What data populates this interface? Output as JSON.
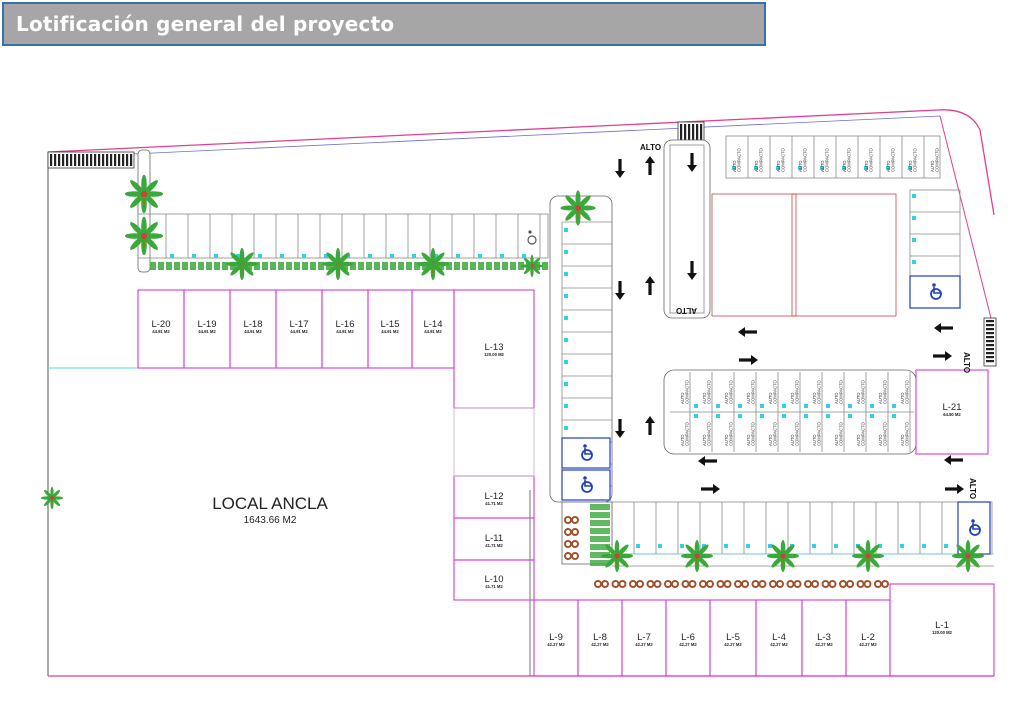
{
  "title": "Lotificación general del proyecto",
  "colors": {
    "banner_bg": "#a6a6a6",
    "banner_border": "#3a6fa7",
    "banner_text": "#ffffff",
    "lot_outline": "#d63ad6",
    "boundary": "#e0408f",
    "parking_line": "#8a8a8a",
    "accessible_blue": "#1f3fbf",
    "plant_green": "#3aa83a",
    "planter_brown": "#a0522d",
    "parking_dot": "#2fd3e6"
  },
  "anchor": {
    "name": "LOCAL ANCLA",
    "area": "1643.66 M2"
  },
  "lots": [
    {
      "id": "L-20",
      "area": "44.91 M2"
    },
    {
      "id": "L-19",
      "area": "44.91 M2"
    },
    {
      "id": "L-18",
      "area": "44.91 M2"
    },
    {
      "id": "L-17",
      "area": "44.91 M2"
    },
    {
      "id": "L-16",
      "area": "44.91 M2"
    },
    {
      "id": "L-15",
      "area": "44.91 M2"
    },
    {
      "id": "L-14",
      "area": "44.91 M2"
    },
    {
      "id": "L-13",
      "area": "120.00 M2"
    },
    {
      "id": "L-12",
      "area": "41.71 M2"
    },
    {
      "id": "L-11",
      "area": "41.71 M2"
    },
    {
      "id": "L-10",
      "area": "41.71 M2"
    },
    {
      "id": "L-9",
      "area": "42.27 M2"
    },
    {
      "id": "L-8",
      "area": "42.27 M2"
    },
    {
      "id": "L-7",
      "area": "42.27 M2"
    },
    {
      "id": "L-6",
      "area": "42.27 M2"
    },
    {
      "id": "L-5",
      "area": "42.27 M2"
    },
    {
      "id": "L-4",
      "area": "42.27 M2"
    },
    {
      "id": "L-3",
      "area": "42.27 M2"
    },
    {
      "id": "L-2",
      "area": "42.27 M2"
    },
    {
      "id": "L-1",
      "area": "120.00 M2"
    },
    {
      "id": "L-21",
      "area": "64.80 M2"
    }
  ],
  "road_labels": [
    "ALTO",
    "ALTO",
    "ALTO",
    "ALTO"
  ],
  "compact_stall_label": [
    "AUTO",
    "COMPACTO"
  ],
  "icons": {
    "accessible": "wheelchair-symbol",
    "palm": "palm-tree-icon",
    "arrow": "traffic-arrow-icon"
  }
}
